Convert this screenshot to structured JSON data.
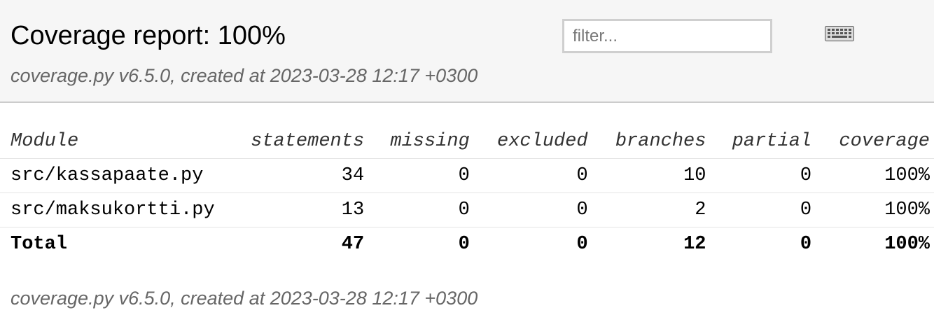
{
  "header": {
    "title": "Coverage report: 100%",
    "filter_placeholder": "filter...",
    "meta": "coverage.py v6.5.0, created at 2023-03-28 12:17 +0300"
  },
  "table": {
    "columns": [
      "Module",
      "statements",
      "missing",
      "excluded",
      "branches",
      "partial",
      "coverage"
    ],
    "rows": [
      {
        "module": "src/kassapaate.py",
        "statements": "34",
        "missing": "0",
        "excluded": "0",
        "branches": "10",
        "partial": "0",
        "coverage": "100%"
      },
      {
        "module": "src/maksukortti.py",
        "statements": "13",
        "missing": "0",
        "excluded": "0",
        "branches": "2",
        "partial": "0",
        "coverage": "100%"
      }
    ],
    "total": {
      "module": "Total",
      "statements": "47",
      "missing": "0",
      "excluded": "0",
      "branches": "12",
      "partial": "0",
      "coverage": "100%"
    }
  },
  "footer": {
    "meta": "coverage.py v6.5.0, created at 2023-03-28 12:17 +0300"
  },
  "icons": {
    "keyboard": "keyboard-icon"
  }
}
